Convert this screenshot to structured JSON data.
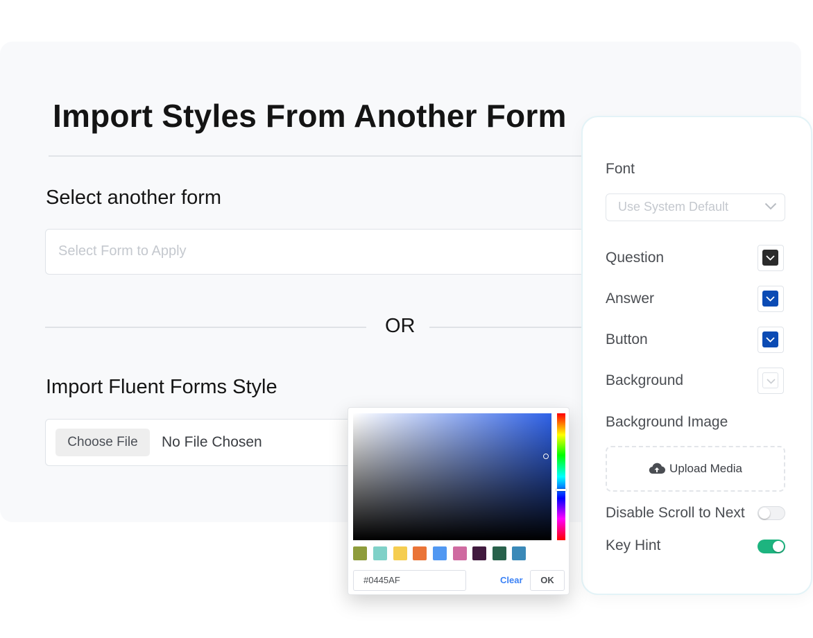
{
  "import_section": {
    "title": "Import Styles From Another Form",
    "select_heading": "Select another form",
    "select_placeholder": "Select Form to Apply",
    "or_label": "OR",
    "import_heading": "Import Fluent Forms Style",
    "choose_file_label": "Choose File",
    "no_file_label": "No File Chosen"
  },
  "settings_panel": {
    "font_label": "Font",
    "font_value": "Use System Default",
    "colors": [
      {
        "label": "Question",
        "color": "#2b2b2b"
      },
      {
        "label": "Answer",
        "color": "#0b4bb4"
      },
      {
        "label": "Button",
        "color": "#0b4bb4"
      },
      {
        "label": "Background",
        "color": "#ffffff"
      }
    ],
    "background_image_label": "Background Image",
    "upload_label": "Upload Media",
    "toggles": [
      {
        "label": "Disable Scroll to Next",
        "on": false
      },
      {
        "label": "Key Hint",
        "on": true
      }
    ]
  },
  "color_picker": {
    "hex_value": "#0445AF",
    "clear_label": "Clear",
    "ok_label": "OK",
    "presets": [
      "#8e9c3b",
      "#7fd1c8",
      "#f5cd50",
      "#ea7437",
      "#5198f2",
      "#cf6aa0",
      "#411a3e",
      "#28614b",
      "#3a89b8"
    ]
  }
}
